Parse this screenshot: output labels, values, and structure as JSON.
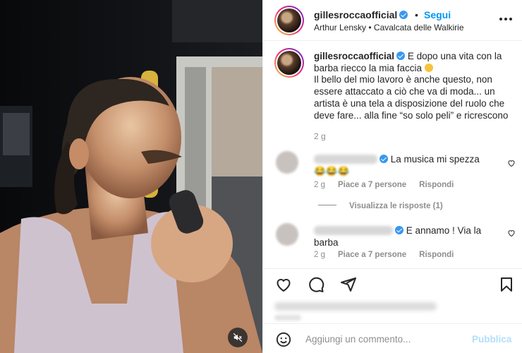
{
  "post": {
    "username": "gillesroccaofficial",
    "separator": "•",
    "follow_label": "Segui",
    "music": "Arthur Lensky • Cavalcata delle Walkirie",
    "caption_username": "gillesroccaofficial",
    "caption_text": "E dopo una vita con la barba riecco la mia faccia",
    "caption_text_2": "Il bello del mio lavoro è anche questo, non essere attaccato a ciò che va di moda... un artista è una tela a disposizione del ruolo che deve fare... alla fine “so solo peli” e ricrescono",
    "caption_time": "2 g"
  },
  "comments": [
    {
      "text": "La musica mi spezza",
      "emoji_row": "😂😂😂",
      "time": "2 g",
      "likes": "Piace a 7 persone",
      "reply": "Rispondi",
      "view_replies": "Visualizza le risposte (1)"
    },
    {
      "text": "E annamo ! Via la barba",
      "time": "2 g",
      "likes": "Piace a 7 persone",
      "reply": "Rispondi"
    }
  ],
  "composer": {
    "placeholder": "Aggiungi un commento...",
    "publish_label": "Pubblica"
  },
  "icons": {
    "mute": "speaker-muted-icon",
    "more": "more-options-icon",
    "like": "heart-icon",
    "comment": "comment-icon",
    "share": "paper-plane-icon",
    "save": "bookmark-icon",
    "emoji": "emoji-icon"
  },
  "colors": {
    "link": "#0095f6",
    "verified": "#3897f0",
    "muted_text": "#8e8e8e",
    "publish_disabled": "#b2dffc"
  }
}
